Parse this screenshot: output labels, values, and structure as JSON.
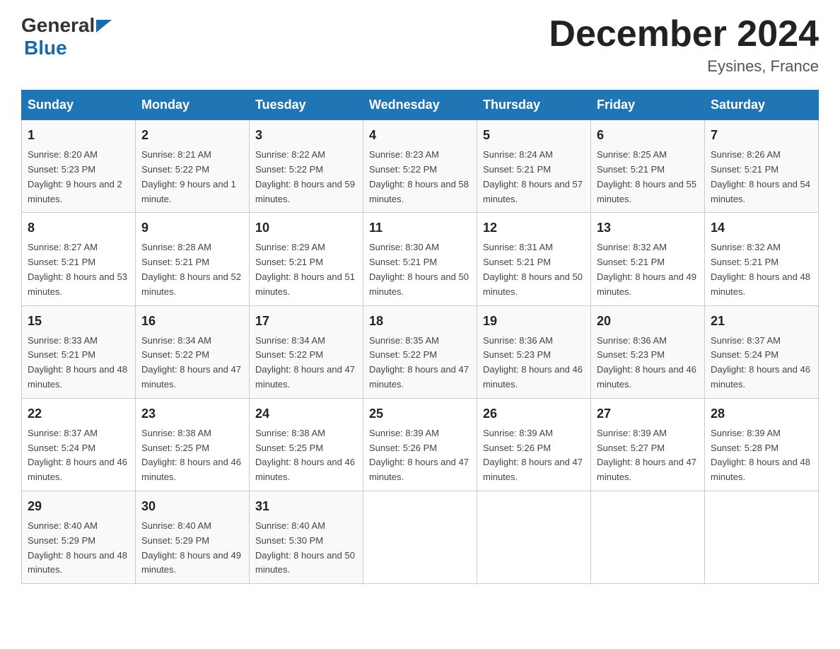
{
  "header": {
    "logo_general": "General",
    "logo_blue": "Blue",
    "month_title": "December 2024",
    "location": "Eysines, France"
  },
  "weekdays": [
    "Sunday",
    "Monday",
    "Tuesday",
    "Wednesday",
    "Thursday",
    "Friday",
    "Saturday"
  ],
  "weeks": [
    [
      {
        "day": "1",
        "sunrise": "8:20 AM",
        "sunset": "5:23 PM",
        "daylight": "9 hours and 2 minutes."
      },
      {
        "day": "2",
        "sunrise": "8:21 AM",
        "sunset": "5:22 PM",
        "daylight": "9 hours and 1 minute."
      },
      {
        "day": "3",
        "sunrise": "8:22 AM",
        "sunset": "5:22 PM",
        "daylight": "8 hours and 59 minutes."
      },
      {
        "day": "4",
        "sunrise": "8:23 AM",
        "sunset": "5:22 PM",
        "daylight": "8 hours and 58 minutes."
      },
      {
        "day": "5",
        "sunrise": "8:24 AM",
        "sunset": "5:21 PM",
        "daylight": "8 hours and 57 minutes."
      },
      {
        "day": "6",
        "sunrise": "8:25 AM",
        "sunset": "5:21 PM",
        "daylight": "8 hours and 55 minutes."
      },
      {
        "day": "7",
        "sunrise": "8:26 AM",
        "sunset": "5:21 PM",
        "daylight": "8 hours and 54 minutes."
      }
    ],
    [
      {
        "day": "8",
        "sunrise": "8:27 AM",
        "sunset": "5:21 PM",
        "daylight": "8 hours and 53 minutes."
      },
      {
        "day": "9",
        "sunrise": "8:28 AM",
        "sunset": "5:21 PM",
        "daylight": "8 hours and 52 minutes."
      },
      {
        "day": "10",
        "sunrise": "8:29 AM",
        "sunset": "5:21 PM",
        "daylight": "8 hours and 51 minutes."
      },
      {
        "day": "11",
        "sunrise": "8:30 AM",
        "sunset": "5:21 PM",
        "daylight": "8 hours and 50 minutes."
      },
      {
        "day": "12",
        "sunrise": "8:31 AM",
        "sunset": "5:21 PM",
        "daylight": "8 hours and 50 minutes."
      },
      {
        "day": "13",
        "sunrise": "8:32 AM",
        "sunset": "5:21 PM",
        "daylight": "8 hours and 49 minutes."
      },
      {
        "day": "14",
        "sunrise": "8:32 AM",
        "sunset": "5:21 PM",
        "daylight": "8 hours and 48 minutes."
      }
    ],
    [
      {
        "day": "15",
        "sunrise": "8:33 AM",
        "sunset": "5:21 PM",
        "daylight": "8 hours and 48 minutes."
      },
      {
        "day": "16",
        "sunrise": "8:34 AM",
        "sunset": "5:22 PM",
        "daylight": "8 hours and 47 minutes."
      },
      {
        "day": "17",
        "sunrise": "8:34 AM",
        "sunset": "5:22 PM",
        "daylight": "8 hours and 47 minutes."
      },
      {
        "day": "18",
        "sunrise": "8:35 AM",
        "sunset": "5:22 PM",
        "daylight": "8 hours and 47 minutes."
      },
      {
        "day": "19",
        "sunrise": "8:36 AM",
        "sunset": "5:23 PM",
        "daylight": "8 hours and 46 minutes."
      },
      {
        "day": "20",
        "sunrise": "8:36 AM",
        "sunset": "5:23 PM",
        "daylight": "8 hours and 46 minutes."
      },
      {
        "day": "21",
        "sunrise": "8:37 AM",
        "sunset": "5:24 PM",
        "daylight": "8 hours and 46 minutes."
      }
    ],
    [
      {
        "day": "22",
        "sunrise": "8:37 AM",
        "sunset": "5:24 PM",
        "daylight": "8 hours and 46 minutes."
      },
      {
        "day": "23",
        "sunrise": "8:38 AM",
        "sunset": "5:25 PM",
        "daylight": "8 hours and 46 minutes."
      },
      {
        "day": "24",
        "sunrise": "8:38 AM",
        "sunset": "5:25 PM",
        "daylight": "8 hours and 46 minutes."
      },
      {
        "day": "25",
        "sunrise": "8:39 AM",
        "sunset": "5:26 PM",
        "daylight": "8 hours and 47 minutes."
      },
      {
        "day": "26",
        "sunrise": "8:39 AM",
        "sunset": "5:26 PM",
        "daylight": "8 hours and 47 minutes."
      },
      {
        "day": "27",
        "sunrise": "8:39 AM",
        "sunset": "5:27 PM",
        "daylight": "8 hours and 47 minutes."
      },
      {
        "day": "28",
        "sunrise": "8:39 AM",
        "sunset": "5:28 PM",
        "daylight": "8 hours and 48 minutes."
      }
    ],
    [
      {
        "day": "29",
        "sunrise": "8:40 AM",
        "sunset": "5:29 PM",
        "daylight": "8 hours and 48 minutes."
      },
      {
        "day": "30",
        "sunrise": "8:40 AM",
        "sunset": "5:29 PM",
        "daylight": "8 hours and 49 minutes."
      },
      {
        "day": "31",
        "sunrise": "8:40 AM",
        "sunset": "5:30 PM",
        "daylight": "8 hours and 50 minutes."
      },
      null,
      null,
      null,
      null
    ]
  ]
}
